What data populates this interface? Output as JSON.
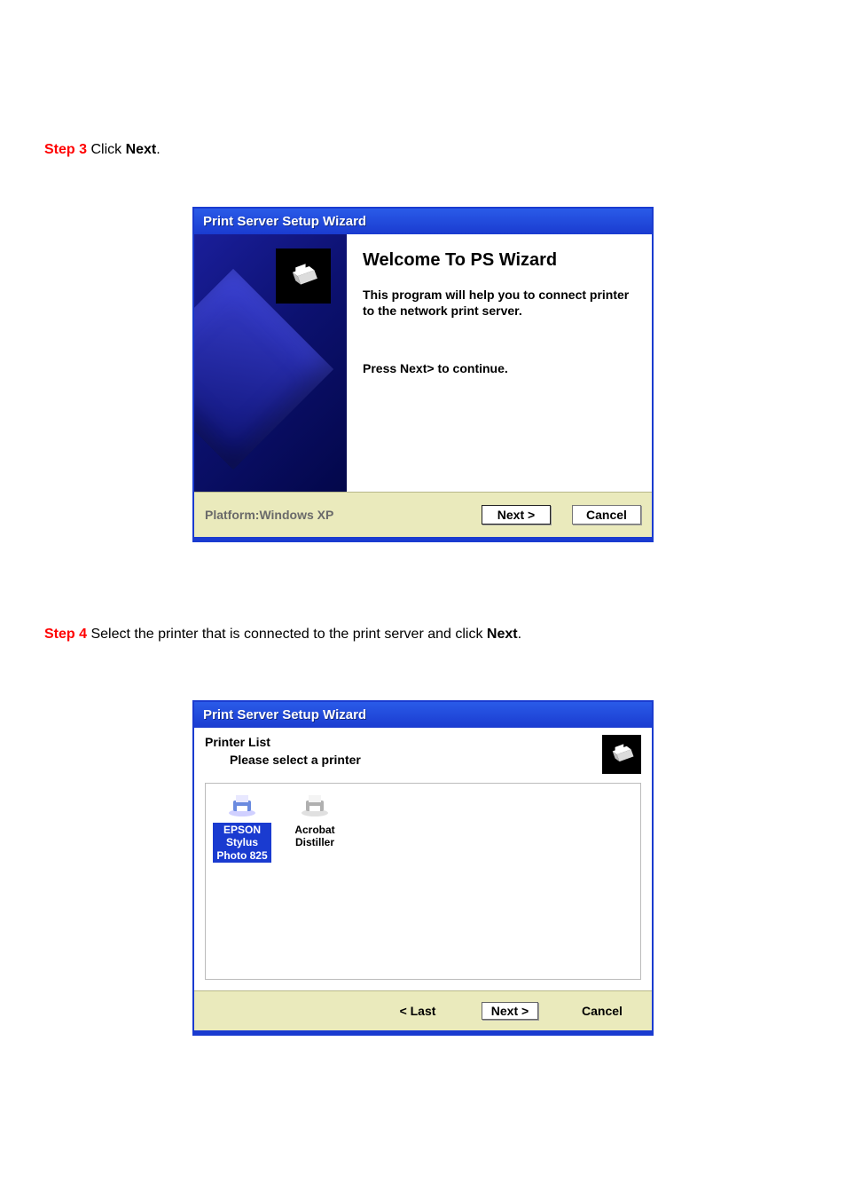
{
  "doc": {
    "step3": {
      "prefix": "Step 3",
      "text": " Click ",
      "bold": "Next",
      "suffix": "."
    },
    "step4": {
      "prefix": "Step 4",
      "text": " Select the printer that is connected to the print server and click ",
      "bold": "Next",
      "suffix": "."
    }
  },
  "wizard1": {
    "title": "Print Server Setup Wizard",
    "heading": "Welcome To PS Wizard",
    "desc": "This program will help you to connect printer to the network print server.",
    "press": "Press Next> to continue.",
    "platform": "Platform:Windows XP",
    "next": "Next >",
    "cancel": "Cancel"
  },
  "wizard2": {
    "title": "Print Server Setup Wizard",
    "line1": "Printer  List",
    "line2": "Please select a printer",
    "printers": [
      {
        "name": "EPSON Stylus Photo 825",
        "selected": true
      },
      {
        "name": "Acrobat Distiller",
        "selected": false
      }
    ],
    "last": "< Last",
    "next": "Next >",
    "cancel": "Cancel"
  }
}
